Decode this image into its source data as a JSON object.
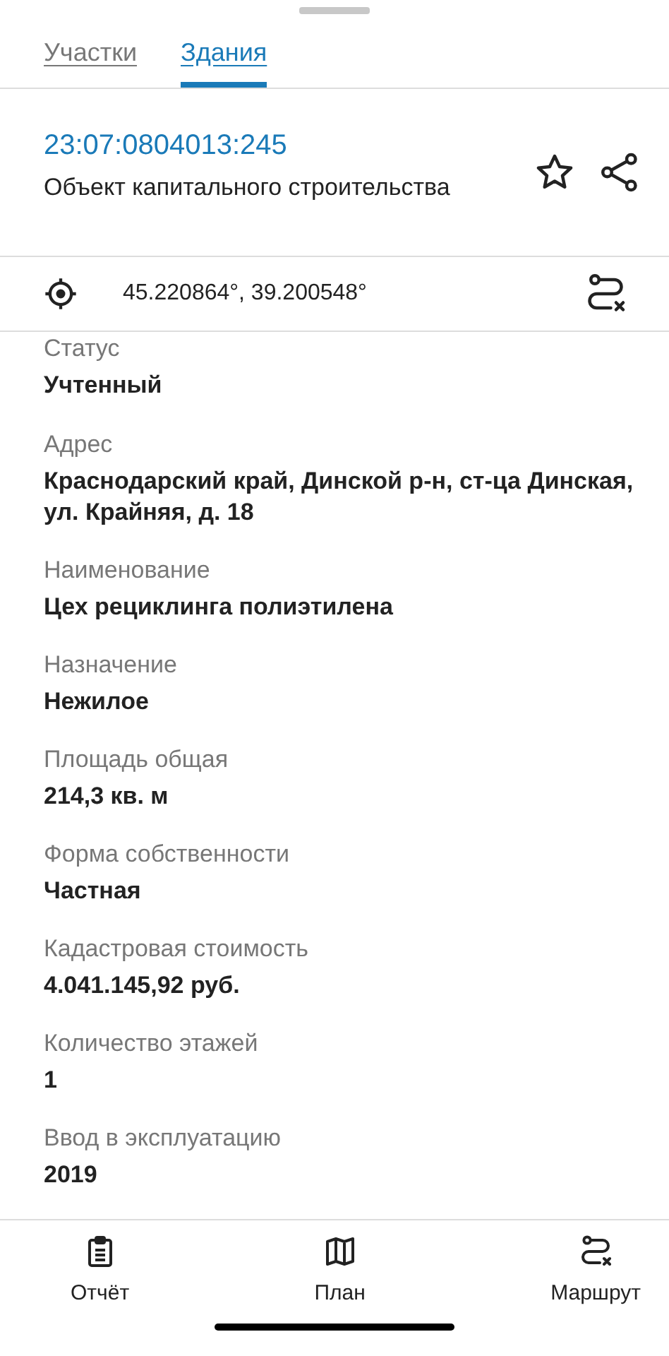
{
  "tabs": [
    {
      "label": "Участки",
      "selected": false
    },
    {
      "label": "Здания",
      "selected": true
    }
  ],
  "object": {
    "cadastral_number": "23:07:0804013:245",
    "type": "Объект капитального строительства",
    "favorite": false
  },
  "coordinates": "45.220864°, 39.200548°",
  "fields": [
    {
      "label": "Статус",
      "value": "Учтенный"
    },
    {
      "label": "Адрес",
      "value": "Краснодарский край, Динской р-н, ст-ца Динская, ул. Крайняя, д. 18"
    },
    {
      "label": "Наименование",
      "value": "Цех рециклинга полиэтилена"
    },
    {
      "label": "Назначение",
      "value": "Нежилое"
    },
    {
      "label": "Площадь общая",
      "value": "214,3 кв. м"
    },
    {
      "label": "Форма собственности",
      "value": "Частная"
    },
    {
      "label": "Кадастровая стоимость",
      "value": "4.041.145,92 руб."
    },
    {
      "label": "Количество этажей",
      "value": "1"
    },
    {
      "label": "Ввод в эксплуатацию",
      "value": "2019"
    }
  ],
  "bottom_nav": [
    {
      "kind": "report",
      "label": "Отчёт"
    },
    {
      "kind": "plan",
      "label": "План"
    },
    {
      "kind": "route",
      "label": "Маршрут"
    }
  ]
}
